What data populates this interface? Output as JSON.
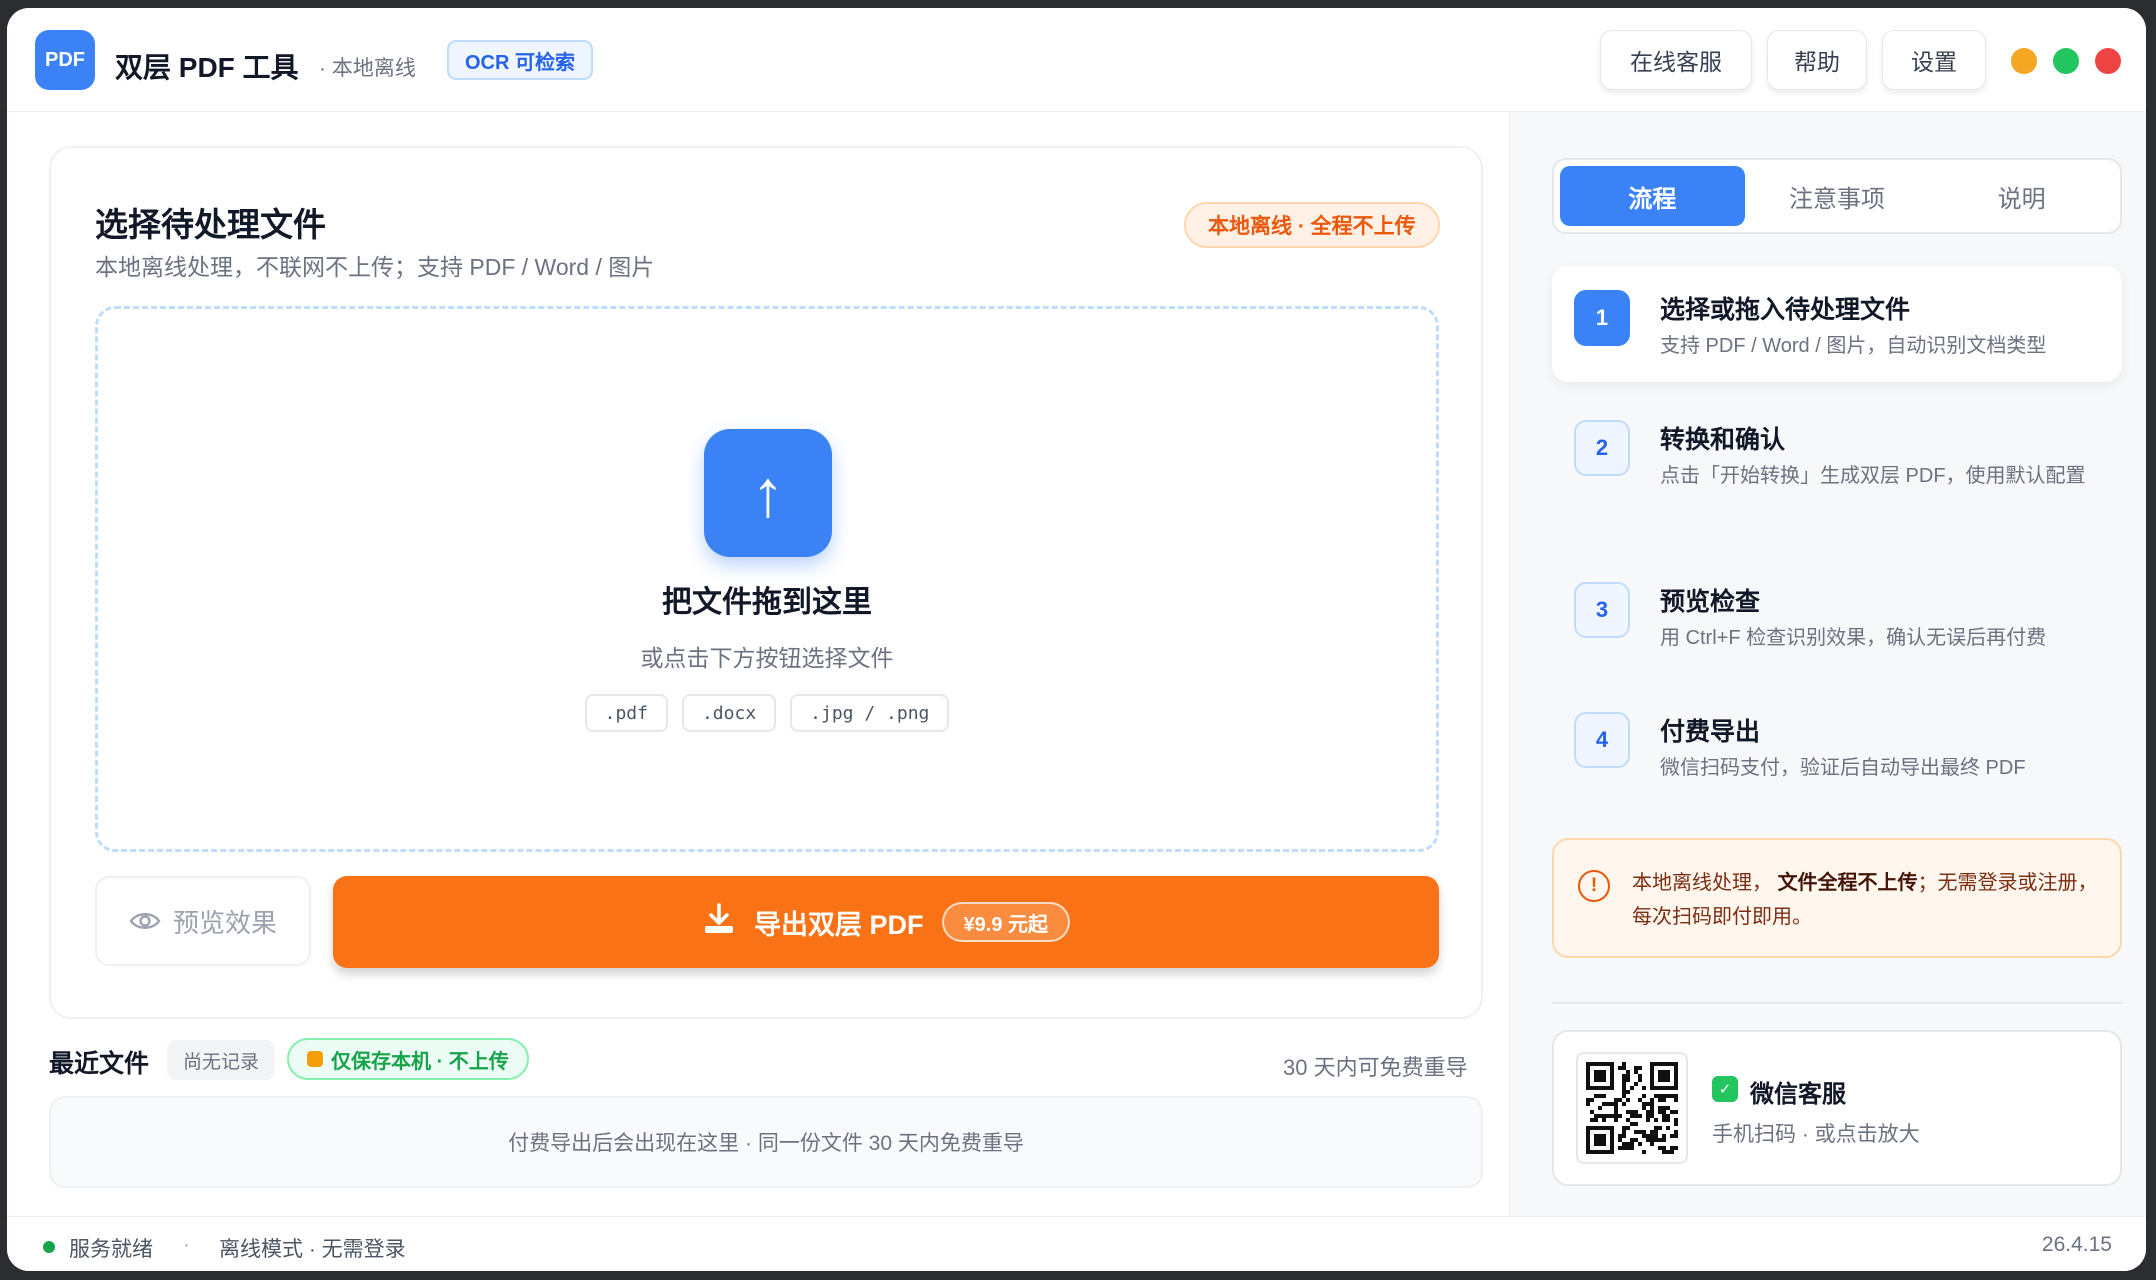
{
  "header": {
    "logo_text": "PDF",
    "title": "双层 PDF 工具",
    "subtitle": "· 本地离线",
    "ocr_badge": "OCR 可检索",
    "buttons": {
      "support": "在线客服",
      "help": "帮助",
      "settings": "设置"
    },
    "window_dots": [
      "#f5a623",
      "#22c55e",
      "#ef4444"
    ]
  },
  "upload": {
    "title": "选择待处理文件",
    "subtitle": "本地离线处理，不联网不上传；支持 PDF / Word / 图片",
    "offline_badge": "本地离线 · 全程不上传",
    "drop_icon": "↑",
    "drop_title": "把文件拖到这里",
    "drop_subtitle": "或点击下方按钮选择文件",
    "extensions": [
      ".pdf",
      ".docx",
      ".jpg / .png"
    ],
    "preview_label": "预览效果",
    "export_label": "导出双层 PDF",
    "export_price": "¥9.9 元起"
  },
  "recent": {
    "title": "最近文件",
    "none_badge": "尚无记录",
    "local_badge": "仅保存本机 · 不上传",
    "note": "30 天内可免费重导",
    "empty_text": "付费导出后会出现在这里 · 同一份文件 30 天内免费重导"
  },
  "sidebar": {
    "tabs": [
      "流程",
      "注意事项",
      "说明"
    ],
    "active_tab": 0,
    "steps": [
      {
        "num": "1",
        "title": "选择或拖入待处理文件",
        "desc": "支持 PDF / Word / 图片，自动识别文档类型"
      },
      {
        "num": "2",
        "title": "转换和确认",
        "desc": "点击「开始转换」生成双层 PDF，使用默认配置"
      },
      {
        "num": "3",
        "title": "预览检查",
        "desc": "用 Ctrl+F 检查识别效果，确认无误后再付费"
      },
      {
        "num": "4",
        "title": "付费导出",
        "desc": "微信扫码支付，验证后自动导出最终 PDF"
      }
    ],
    "notice": {
      "prefix": "本地离线处理，",
      "bold": "文件全程不上传",
      "suffix": "；无需登录或注册，每次扫码即付即用。"
    },
    "wechat": {
      "title": "微信客服",
      "subtitle": "手机扫码 · 或点击放大"
    }
  },
  "status": {
    "ready": "服务就绪",
    "separator": "·",
    "mode": "离线模式 · 无需登录",
    "version": "26.4.15"
  }
}
